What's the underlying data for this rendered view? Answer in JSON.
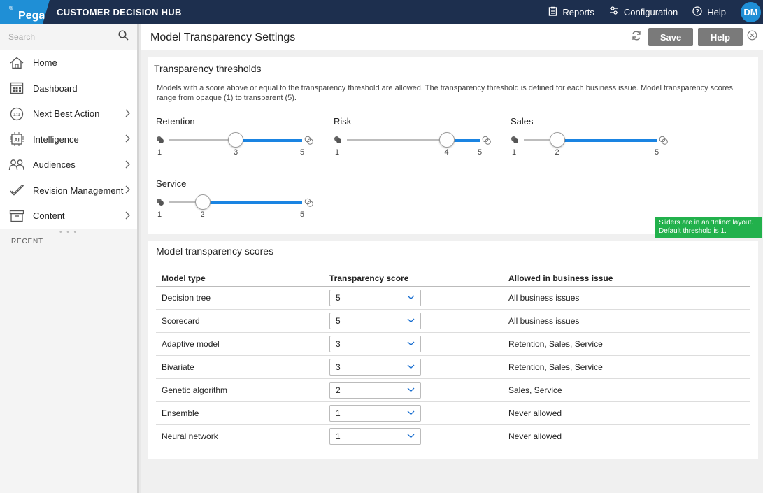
{
  "topbar": {
    "logo": "Pega",
    "logo_mark": "®",
    "app_title": "CUSTOMER DECISION HUB",
    "nav": [
      {
        "label": "Reports",
        "icon": "clipboard-icon"
      },
      {
        "label": "Configuration",
        "icon": "sliders-icon"
      },
      {
        "label": "Help",
        "icon": "question-icon"
      }
    ],
    "avatar": "DM"
  },
  "sidebar": {
    "search_placeholder": "Search",
    "items": [
      {
        "label": "Home",
        "icon": "home-icon",
        "chevron": false
      },
      {
        "label": "Dashboard",
        "icon": "dashboard-icon",
        "chevron": false
      },
      {
        "label": "Next Best Action",
        "icon": "one-to-one-icon",
        "chevron": true
      },
      {
        "label": "Intelligence",
        "icon": "ai-chip-icon",
        "chevron": true
      },
      {
        "label": "Audiences",
        "icon": "people-icon",
        "chevron": true
      },
      {
        "label": "Revision Management",
        "icon": "check-icon",
        "chevron": true
      },
      {
        "label": "Content",
        "icon": "archive-icon",
        "chevron": true
      }
    ],
    "recent_label": "RECENT"
  },
  "header": {
    "title": "Model Transparency Settings",
    "save_label": "Save",
    "help_label": "Help"
  },
  "thresholds": {
    "title": "Transparency thresholds",
    "description": "Models with a score above or equal to the transparency threshold are allowed. The transparency threshold is defined for each business issue. Model transparency scores range from opaque (1) to transparent (5).",
    "min": 1,
    "max": 5,
    "min_label": "1",
    "max_label": "5",
    "sliders": [
      {
        "name": "Retention",
        "value": 3,
        "value_label": "3"
      },
      {
        "name": "Risk",
        "value": 4,
        "value_label": "4"
      },
      {
        "name": "Sales",
        "value": 2,
        "value_label": "2"
      },
      {
        "name": "Service",
        "value": 2,
        "value_label": "2"
      }
    ]
  },
  "tooltip": {
    "line1": "Sliders are in an 'Inline' layout.",
    "line2": "Default threshold is 1."
  },
  "scores": {
    "title": "Model transparency scores",
    "columns": [
      "Model type",
      "Transparency score",
      "Allowed in business issue"
    ],
    "rows": [
      {
        "model": "Decision tree",
        "score": "5",
        "allowed": "All business issues"
      },
      {
        "model": "Scorecard",
        "score": "5",
        "allowed": "All business issues"
      },
      {
        "model": "Adaptive model",
        "score": "3",
        "allowed": "Retention, Sales, Service"
      },
      {
        "model": "Bivariate",
        "score": "3",
        "allowed": "Retention, Sales, Service"
      },
      {
        "model": "Genetic algorithm",
        "score": "2",
        "allowed": "Sales, Service"
      },
      {
        "model": "Ensemble",
        "score": "1",
        "allowed": "Never allowed"
      },
      {
        "model": "Neural network",
        "score": "1",
        "allowed": "Never allowed"
      }
    ]
  },
  "colors": {
    "topbar": "#1d2f4e",
    "brand_blue": "#1f8fd6",
    "slider_fill": "#1a84e2",
    "tooltip_green": "#22b14c",
    "button_gray": "#7a7a7a"
  }
}
